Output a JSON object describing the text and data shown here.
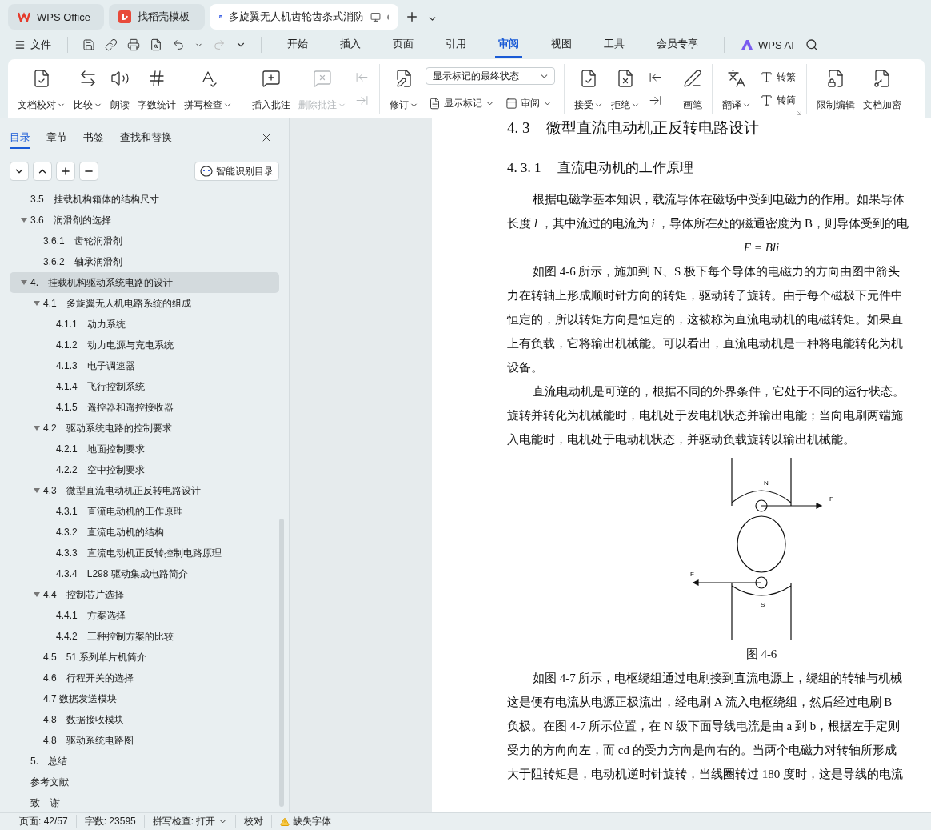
{
  "tabs": [
    {
      "label": "WPS Office",
      "kind": "home",
      "selected": false
    },
    {
      "label": "找稻壳模板",
      "kind": "template",
      "selected": false
    },
    {
      "label": "多旋翼无人机齿轮齿条式消防",
      "kind": "document",
      "selected": true
    }
  ],
  "menu": {
    "file": "文件",
    "tabs": [
      {
        "label": "开始",
        "selected": false
      },
      {
        "label": "插入",
        "selected": false
      },
      {
        "label": "页面",
        "selected": false
      },
      {
        "label": "引用",
        "selected": false
      },
      {
        "label": "审阅",
        "selected": true
      },
      {
        "label": "视图",
        "selected": false
      },
      {
        "label": "工具",
        "selected": false
      },
      {
        "label": "会员专享",
        "selected": false
      }
    ],
    "ai": "WPS AI"
  },
  "ribbon": {
    "groups": [
      {
        "items": [
          {
            "kind": "large",
            "label": "文档校对",
            "menu": true,
            "disabled": false
          },
          {
            "kind": "large",
            "label": "比较",
            "menu": true,
            "disabled": false
          },
          {
            "kind": "large",
            "label": "朗读",
            "menu": false,
            "disabled": false
          },
          {
            "kind": "large",
            "label": "字数统计",
            "menu": false,
            "disabled": false
          },
          {
            "kind": "large",
            "label": "拼写检查",
            "menu": true,
            "disabled": false
          }
        ]
      },
      {
        "items": [
          {
            "kind": "large",
            "label": "插入批注",
            "menu": false,
            "disabled": false
          },
          {
            "kind": "large",
            "label": "删除批注",
            "menu": true,
            "disabled": true
          },
          {
            "kind": "stack",
            "items": [
              {
                "kind": "icon",
                "disabled": true
              },
              {
                "kind": "icon",
                "disabled": true
              }
            ]
          }
        ]
      },
      {
        "items": [
          {
            "kind": "large",
            "label": "修订",
            "menu": true,
            "disabled": false
          },
          {
            "kind": "panel",
            "select": "显示标记的最终状态",
            "items": [
              {
                "label": "显示标记",
                "menu": true,
                "disabled": false
              },
              {
                "label": "审阅",
                "menu": true,
                "disabled": false
              }
            ]
          }
        ]
      },
      {
        "items": [
          {
            "kind": "large",
            "label": "接受",
            "menu": true,
            "disabled": false
          },
          {
            "kind": "large",
            "label": "拒绝",
            "menu": true,
            "disabled": false
          },
          {
            "kind": "stack",
            "items": [
              {
                "kind": "icon",
                "disabled": false
              },
              {
                "kind": "icon",
                "disabled": false
              }
            ]
          }
        ]
      },
      {
        "items": [
          {
            "kind": "large",
            "label": "画笔",
            "menu": false,
            "disabled": false
          }
        ]
      },
      {
        "launcher": true,
        "items": [
          {
            "kind": "large",
            "label": "翻译",
            "menu": true,
            "disabled": false
          },
          {
            "kind": "stack",
            "items": [
              {
                "kind": "small",
                "label": "转繁",
                "menu": false,
                "disabled": false
              },
              {
                "kind": "small",
                "label": "转简",
                "menu": false,
                "disabled": false
              }
            ]
          }
        ]
      },
      {
        "items": [
          {
            "kind": "large",
            "label": "限制编辑",
            "menu": false,
            "disabled": false
          },
          {
            "kind": "large",
            "label": "文档加密",
            "menu": false,
            "disabled": false
          }
        ]
      }
    ]
  },
  "sidebar": {
    "tabs": [
      {
        "label": "目录",
        "selected": true
      },
      {
        "label": "章节",
        "selected": false
      },
      {
        "label": "书签",
        "selected": false
      },
      {
        "label": "查找和替换",
        "selected": false
      }
    ],
    "smart_button": "智能识别目录",
    "toc": [
      {
        "children": [
          {
            "number": "3.5",
            "label": "挂载机构箱体的结构尺寸",
            "selected": false
          },
          {
            "number": "3.6",
            "label": "润滑剂的选择",
            "selected": false,
            "expanded": true,
            "children": [
              {
                "number": "3.6.1",
                "label": "齿轮润滑剂",
                "selected": false
              },
              {
                "number": "3.6.2",
                "label": "轴承润滑剂",
                "selected": false
              }
            ]
          }
        ]
      },
      {
        "number": "4.",
        "label": "挂载机构驱动系统电路的设计",
        "selected": true,
        "expanded": true,
        "children": [
          {
            "number": "4.1",
            "label": "多旋翼无人机电路系统的组成",
            "selected": false,
            "expanded": true,
            "children": [
              {
                "number": "4.1.1",
                "label": "动力系统",
                "selected": false
              },
              {
                "number": "4.1.2",
                "label": "动力电源与充电系统",
                "selected": false
              },
              {
                "number": "4.1.3",
                "label": "电子调速器",
                "selected": false
              },
              {
                "number": "4.1.4",
                "label": "飞行控制系统",
                "selected": false
              },
              {
                "number": "4.1.5",
                "label": "遥控器和遥控接收器",
                "selected": false
              }
            ]
          },
          {
            "number": "4.2",
            "label": "驱动系统电路的控制要求",
            "selected": false,
            "expanded": true,
            "children": [
              {
                "number": "4.2.1",
                "label": "地面控制要求",
                "selected": false
              },
              {
                "number": "4.2.2",
                "label": "空中控制要求",
                "selected": false
              }
            ]
          },
          {
            "number": "4.3",
            "label": "微型直流电动机正反转电路设计",
            "selected": false,
            "expanded": true,
            "children": [
              {
                "number": "4.3.1",
                "label": "直流电动机的工作原理",
                "selected": false
              },
              {
                "number": "4.3.2",
                "label": "直流电动机的结构",
                "selected": false
              },
              {
                "number": "4.3.3",
                "label": "直流电动机正反转控制电路原理",
                "selected": false
              },
              {
                "number": "4.3.4",
                "label": "L298 驱动集成电路简介",
                "selected": false
              }
            ]
          },
          {
            "number": "4.4",
            "label": "控制芯片选择",
            "selected": false,
            "expanded": true,
            "children": [
              {
                "number": "4.4.1",
                "label": "方案选择",
                "selected": false
              },
              {
                "number": "4.4.2",
                "label": "三种控制方案的比较",
                "selected": false
              }
            ]
          },
          {
            "number": "4.5",
            "label": "51 系列单片机简介",
            "selected": false
          },
          {
            "number": "4.6",
            "label": "行程开关的选择",
            "selected": false
          },
          {
            "label": "4.7 数据发送模块",
            "selected": false
          },
          {
            "number": "4.8",
            "label": "数据接收模块",
            "selected": false
          },
          {
            "number": "4.8",
            "label": "驱动系统电路图",
            "selected": false
          }
        ]
      },
      {
        "number": "5.",
        "label": "总结",
        "selected": false
      },
      {
        "label": "参考文献",
        "selected": false
      },
      {
        "label": "致    谢",
        "selected": false
      }
    ]
  },
  "document": {
    "blocks": [
      {
        "kind": "heading",
        "number": "4. 3",
        "text": "微型直流电动机正反转电路设计"
      },
      {
        "kind": "subheading",
        "number": "4. 3. 1",
        "text": "直流电动机的工作原理"
      },
      {
        "kind": "paragraph",
        "lines": [
          "根据电磁学基本知识，载流导体在磁场中受到电磁力的作用。如果导体",
          "长度 *l* ，其中流过的电流为 *i* ，导体所在处的磁通密度为 B，则导体受到的电"
        ]
      },
      {
        "kind": "formula",
        "text": "F = Bli"
      },
      {
        "kind": "paragraph",
        "lines": [
          "如图 4-6 所示，施加到 N、S 极下每个导体的电磁力的方向由图中箭头",
          "力在转轴上形成顺时针方向的转矩，驱动转子旋转。由于每个磁极下元件中",
          "恒定的，所以转矩方向是恒定的，这被称为直流电动机的电磁转矩。如果直",
          "上有负载，它将输出机械能。可以看出，直流电动机是一种将电能转化为机",
          "设备。"
        ]
      },
      {
        "kind": "paragraph",
        "lines": [
          "直流电动机是可逆的，根据不同的外界条件，它处于不同的运行状态。",
          "旋转并转化为机械能时，电机处于发电机状态并输出电能；当向电刷两端施",
          "入电能时，电机处于电动机状态，并驱动负载旋转以输出机械能。"
        ]
      },
      {
        "kind": "figure",
        "labels": [
          "N",
          "F",
          "F",
          "S"
        ],
        "caption": "图 4-6"
      },
      {
        "kind": "paragraph",
        "lines": [
          "如图 4-7 所示，电枢绕组通过电刷接到直流电源上，绕组的转轴与机械",
          "这是便有电流从电源正极流出，经电刷 A 流入电枢绕组，然后经过电刷 B",
          "负极。在图 4-7 所示位置，在 N 级下面导线电流是由 a 到 b，根据左手定则",
          "受力的方向向左，而 cd 的受力方向是向右的。当两个电磁力对转轴所形成",
          "大于阻转矩是，电动机逆时针旋转，当线圈转过 180 度时，这是导线的电流"
        ]
      }
    ]
  },
  "status_bar": {
    "items": [
      {
        "kind": "text",
        "label": "页面: 42/57"
      },
      {
        "kind": "text",
        "label": "字数: 23595"
      },
      {
        "kind": "dropdown",
        "label": "拼写检查: 打开"
      },
      {
        "kind": "text",
        "label": "校对"
      },
      {
        "kind": "warning",
        "label": "缺失字体"
      }
    ]
  }
}
